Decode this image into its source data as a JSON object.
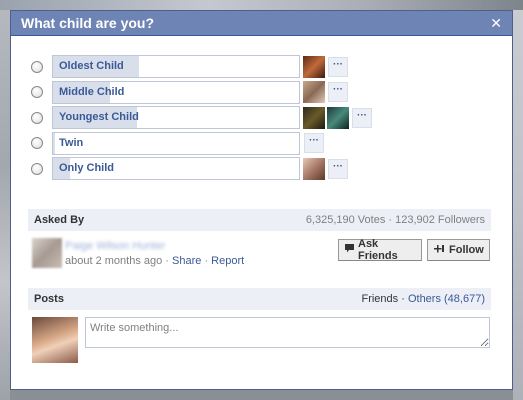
{
  "dialog": {
    "title": "What child are you?",
    "close_glyph": "✕"
  },
  "options": [
    {
      "label": "Oldest Child",
      "fill_percent": 35,
      "avatars": [
        "av1"
      ],
      "more": "···"
    },
    {
      "label": "Middle Child",
      "fill_percent": 23,
      "avatars": [
        "av2"
      ],
      "more": "···"
    },
    {
      "label": "Youngest Child",
      "fill_percent": 34,
      "avatars": [
        "av3",
        "av4"
      ],
      "more": "···"
    },
    {
      "label": "Twin",
      "fill_percent": 1,
      "avatars": [],
      "more": "···"
    },
    {
      "label": "Only Child",
      "fill_percent": 7,
      "avatars": [
        "av5"
      ],
      "more": "···"
    }
  ],
  "asked": {
    "label": "Asked By",
    "stats": "6,325,190 Votes · 123,902 Followers",
    "asker_name": "Paige Wilson Hunter",
    "time": "about 2 months ago",
    "sep1": " · ",
    "share": "Share",
    "sep2": " · ",
    "report": "Report",
    "ask_friends": "Ask Friends",
    "follow": "Follow",
    "ask_icon": "speech-bubble-icon",
    "follow_icon": "add-follow-icon"
  },
  "posts": {
    "label": "Posts",
    "friends": "Friends",
    "sep": " · ",
    "others": "Others (48,677)",
    "placeholder": "Write something..."
  },
  "colors": {
    "titlebar": "#6d84b4",
    "link": "#3b5998",
    "bar": "#eceff5",
    "fill": "#d8dfea"
  }
}
